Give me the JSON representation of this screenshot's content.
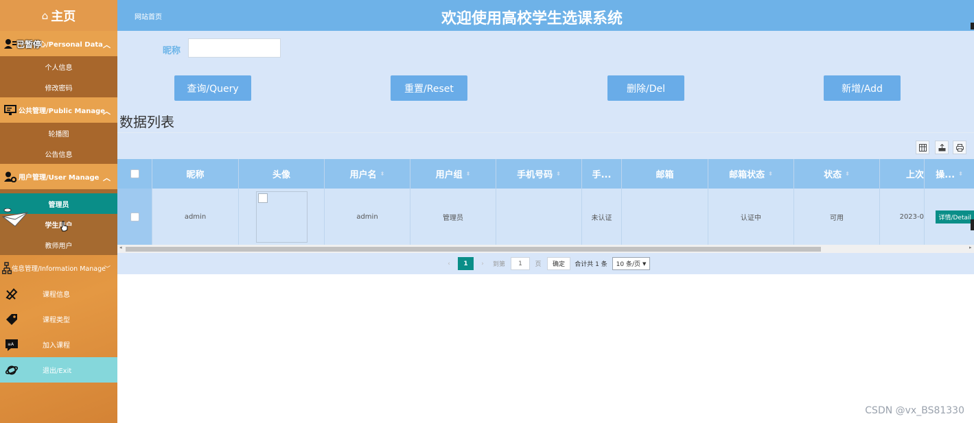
{
  "sidebar": {
    "home_label": "主页",
    "home_icon": "home-icon",
    "personal": {
      "heading": "个人中心/Personal Data",
      "overlay_text": "已暂停",
      "items": [
        "个人信息",
        "修改密码"
      ]
    },
    "public": {
      "heading": "公共管理/Public Manage",
      "items": [
        "轮播图",
        "公告信息"
      ]
    },
    "user": {
      "heading": "用户管理/User Manage",
      "items": [
        "管理员",
        "学生用户",
        "教师用户"
      ],
      "active_index": 0
    },
    "info": {
      "heading": "信息管理/Information Manage",
      "items": [
        "课程信息",
        "课程类型",
        "加入课程"
      ]
    },
    "exit_label": "退出/Exit"
  },
  "header": {
    "crumb": "网站首页",
    "title": "欢迎使用高校学生选课系统"
  },
  "search": {
    "label": "昵称",
    "value": "",
    "placeholder": ""
  },
  "buttons": {
    "query": "查询/Query",
    "reset": "重置/Reset",
    "delete": "删除/Del",
    "add": "新增/Add"
  },
  "list_title": "数据列表",
  "table": {
    "columns": [
      "昵称",
      "头像",
      "用户名",
      "用户组",
      "手机号码",
      "手...",
      "邮箱",
      "邮箱状态",
      "状态",
      "上次",
      "操..."
    ],
    "rows": [
      {
        "nickname": "admin",
        "username": "admin",
        "group": "管理员",
        "phone": "",
        "phone_status": "未认证",
        "email": "",
        "email_status": "认证中",
        "status": "可用",
        "last": "2023-0",
        "action": "详情/Detail"
      }
    ]
  },
  "pager": {
    "current": "1",
    "goto_label": "到第",
    "goto_value": "1",
    "page_unit": "页",
    "confirm": "确定",
    "total": "合计共 1 条",
    "per_page": "10 条/页"
  },
  "watermark": "CSDN @vx_BS81330",
  "colors": {
    "sidebar": "#e2923c",
    "header": "#6eb2e8",
    "button": "#69ace8",
    "active": "#0a8e88",
    "exit": "#85d7db"
  }
}
